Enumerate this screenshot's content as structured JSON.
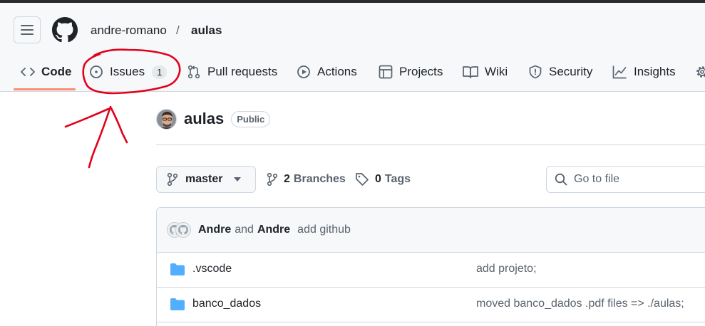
{
  "header": {
    "owner": "andre-romano",
    "separator": "/",
    "repo": "aulas"
  },
  "tabs": [
    {
      "label": "Code",
      "icon": "code-icon",
      "active": true
    },
    {
      "label": "Issues",
      "icon": "issue-opened-icon",
      "counter": "1"
    },
    {
      "label": "Pull requests",
      "icon": "git-pull-request-icon"
    },
    {
      "label": "Actions",
      "icon": "play-icon"
    },
    {
      "label": "Projects",
      "icon": "table-icon"
    },
    {
      "label": "Wiki",
      "icon": "book-icon"
    },
    {
      "label": "Security",
      "icon": "shield-icon"
    },
    {
      "label": "Insights",
      "icon": "graph-icon"
    }
  ],
  "repo_header": {
    "name": "aulas",
    "visibility": "Public"
  },
  "toolbar": {
    "branch": "master",
    "branches_count": "2",
    "branches_label": "Branches",
    "tags_count": "0",
    "tags_label": "Tags",
    "search_placeholder": "Go to file"
  },
  "commit": {
    "author1": "Andre",
    "and": "and",
    "author2": "Andre",
    "message": "add github"
  },
  "files": [
    {
      "name": ".vscode",
      "type": "folder",
      "message": "add projeto;"
    },
    {
      "name": "banco_dados",
      "type": "folder",
      "message": "moved banco_dados .pdf files => ./aulas;"
    }
  ],
  "colors": {
    "annotation": "#e3001b",
    "active_tab_underline": "#fd8c73",
    "folder": "#54aeff"
  }
}
